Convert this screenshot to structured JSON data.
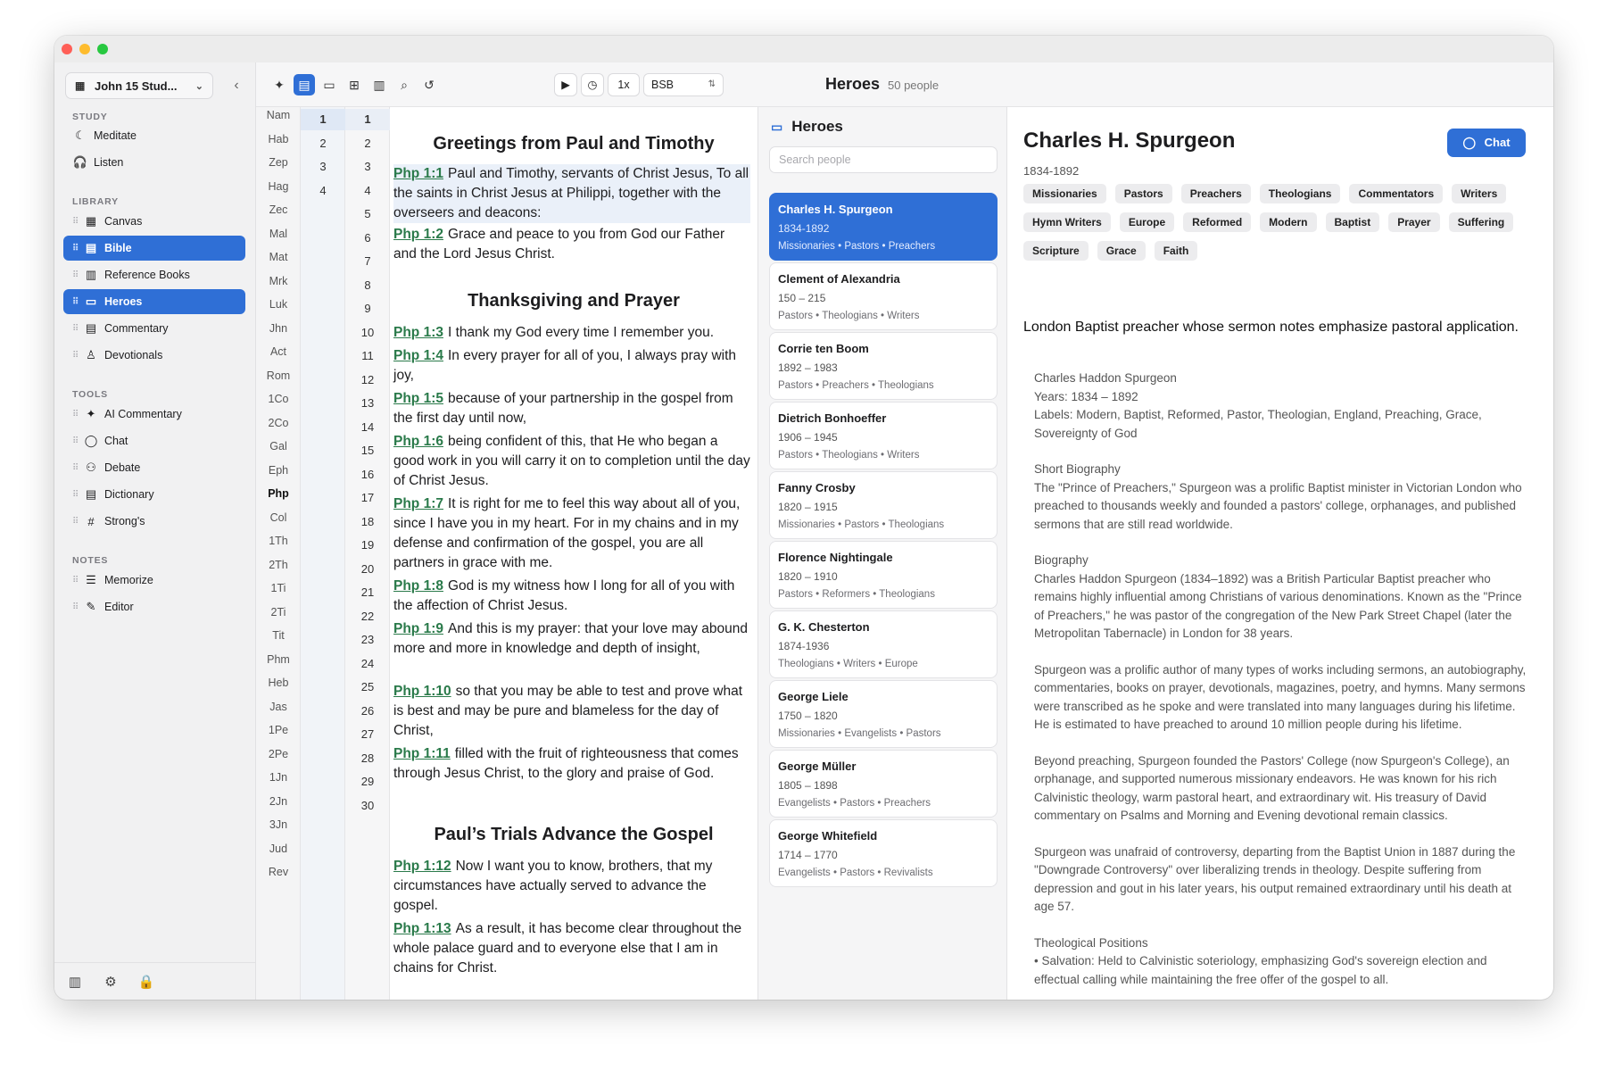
{
  "workspace": {
    "name": "John 15 Stud..."
  },
  "sidebar": {
    "sections": [
      {
        "title": "STUDY",
        "items": [
          {
            "label": "Meditate",
            "icon": "moon-icon"
          },
          {
            "label": "Listen",
            "icon": "headphones-icon"
          }
        ]
      },
      {
        "title": "LIBRARY",
        "items": [
          {
            "label": "Canvas"
          },
          {
            "label": "Bible"
          },
          {
            "label": "Reference Books"
          },
          {
            "label": "Heroes"
          },
          {
            "label": "Commentary"
          },
          {
            "label": "Devotionals"
          }
        ]
      },
      {
        "title": "TOOLS",
        "items": [
          {
            "label": "AI Commentary"
          },
          {
            "label": "Chat"
          },
          {
            "label": "Debate"
          },
          {
            "label": "Dictionary"
          },
          {
            "label": "Strong's"
          }
        ]
      },
      {
        "title": "NOTES",
        "items": [
          {
            "label": "Memorize"
          },
          {
            "label": "Editor"
          }
        ]
      }
    ]
  },
  "toolbar": {
    "speed": "1x",
    "translation": "BSB",
    "panel_title": "Heroes",
    "panel_count": "50 people"
  },
  "books": [
    "Nam",
    "Hab",
    "Zep",
    "Hag",
    "Zec",
    "Mal",
    "Mat",
    "Mrk",
    "Luk",
    "Jhn",
    "Act",
    "Rom",
    "1Co",
    "2Co",
    "Gal",
    "Eph",
    "Php",
    "Col",
    "1Th",
    "2Th",
    "1Ti",
    "2Ti",
    "Tit",
    "Phm",
    "Heb",
    "Jas",
    "1Pe",
    "2Pe",
    "1Jn",
    "2Jn",
    "3Jn",
    "Jud",
    "Rev"
  ],
  "chapters": [
    "1",
    "2",
    "3",
    "4"
  ],
  "verse_numbers": [
    "1",
    "2",
    "3",
    "4",
    "5",
    "6",
    "7",
    "8",
    "9",
    "10",
    "11",
    "12",
    "13",
    "14",
    "15",
    "16",
    "17",
    "18",
    "19",
    "20",
    "21",
    "22",
    "23",
    "24",
    "25",
    "26",
    "27",
    "28",
    "29",
    "30"
  ],
  "bible": {
    "sections": [
      "Greetings from Paul and Timothy",
      "Thanksgiving and Prayer",
      "Paul’s Trials Advance the Gospel"
    ],
    "verses": [
      {
        "ref": "Php 1:1",
        "text": "Paul and Timothy, servants of Christ Jesus, To all the saints in Christ Jesus at Philippi, together with the overseers and deacons:"
      },
      {
        "ref": "Php 1:2",
        "text": "Grace and peace to you from God our Father and the Lord Jesus Christ."
      },
      {
        "ref": "Php 1:3",
        "text": "I thank my God every time I remember you."
      },
      {
        "ref": "Php 1:4",
        "text": "In every prayer for all of you, I always pray with joy,"
      },
      {
        "ref": "Php 1:5",
        "text": "because of your partnership in the gospel from the first day until now,"
      },
      {
        "ref": "Php 1:6",
        "text": "being confident of this, that He who began a good work in you will carry it on to completion until the day of Christ Jesus."
      },
      {
        "ref": "Php 1:7",
        "text": "It is right for me to feel this way about all of you, since I have you in my heart. For in my chains and in my defense and confirmation of the gospel, you are all partners in grace with me."
      },
      {
        "ref": "Php 1:8",
        "text": "God is my witness how I long for all of you with the affection of Christ Jesus."
      },
      {
        "ref": "Php 1:9",
        "text": "And this is my prayer: that your love may abound more and more in knowledge and depth of insight,"
      },
      {
        "ref": "Php 1:10",
        "text": "so that you may be able to test and prove what is best and may be pure and blameless for the day of Christ,"
      },
      {
        "ref": "Php 1:11",
        "text": "filled with the fruit of righteousness that comes through Jesus Christ, to the glory and praise of God."
      },
      {
        "ref": "Php 1:12",
        "text": "Now I want you to know, brothers, that my circumstances have actually served to advance the gospel."
      },
      {
        "ref": "Php 1:13",
        "text": "As a result, it has become clear throughout the whole palace guard and to everyone else that I am in chains for Christ."
      }
    ]
  },
  "heroes": {
    "title": "Heroes",
    "search_placeholder": "Search people",
    "people": [
      {
        "name": "Charles H. Spurgeon",
        "years": "1834-1892",
        "tags": "Missionaries • Pastors • Preachers"
      },
      {
        "name": "Clement of Alexandria",
        "years": "150 – 215",
        "tags": "Pastors • Theologians • Writers"
      },
      {
        "name": "Corrie ten Boom",
        "years": "1892 – 1983",
        "tags": "Pastors • Preachers • Theologians"
      },
      {
        "name": "Dietrich Bonhoeffer",
        "years": "1906 – 1945",
        "tags": "Pastors • Theologians • Writers"
      },
      {
        "name": "Fanny Crosby",
        "years": "1820 – 1915",
        "tags": "Missionaries • Pastors • Theologians"
      },
      {
        "name": "Florence Nightingale",
        "years": "1820 – 1910",
        "tags": "Pastors • Reformers • Theologians"
      },
      {
        "name": "G. K. Chesterton",
        "years": "1874-1936",
        "tags": "Theologians • Writers • Europe"
      },
      {
        "name": "George Liele",
        "years": "1750 – 1820",
        "tags": "Missionaries • Evangelists • Pastors"
      },
      {
        "name": "George Müller",
        "years": "1805 – 1898",
        "tags": "Evangelists • Pastors • Preachers"
      },
      {
        "name": "George Whitefield",
        "years": "1714 – 1770",
        "tags": "Evangelists • Pastors • Revivalists"
      }
    ]
  },
  "detail": {
    "name": "Charles H. Spurgeon",
    "years": "1834-1892",
    "chat_label": "Chat",
    "chips": [
      "Missionaries",
      "Pastors",
      "Preachers",
      "Theologians",
      "Commentators",
      "Writers",
      "Hymn Writers",
      "Europe",
      "Reformed",
      "Modern",
      "Baptist",
      "Prayer",
      "Suffering",
      "Scripture",
      "Grace",
      "Faith"
    ],
    "summary": "London Baptist preacher whose sermon notes emphasize pastoral application.",
    "paragraphs": [
      [
        "Charles Haddon Spurgeon",
        "Years: 1834 – 1892",
        "Labels: Modern, Baptist, Reformed, Pastor, Theologian, England, Preaching, Grace, Sovereignty of God"
      ],
      [
        "Short Biography",
        "The \"Prince of Preachers,\" Spurgeon was a prolific Baptist minister in Victorian London who preached to thousands weekly and founded a pastors' college, orphanages, and published sermons that are still read worldwide."
      ],
      [
        "Biography",
        "Charles Haddon Spurgeon (1834–1892) was a British Particular Baptist preacher who remains highly influential among Christians of various denominations. Known as the \"Prince of Preachers,\" he was pastor of the congregation of the New Park Street Chapel (later the Metropolitan Tabernacle) in London for 38 years."
      ],
      [
        "Spurgeon was a prolific author of many types of works including sermons, an autobiography, commentaries, books on prayer, devotionals, magazines, poetry, and hymns. Many sermons were transcribed as he spoke and were translated into many languages during his lifetime. He is estimated to have preached to around 10 million people during his lifetime."
      ],
      [
        "Beyond preaching, Spurgeon founded the Pastors' College (now Spurgeon's College), an orphanage, and supported numerous missionary endeavors. He was known for his rich Calvinistic theology, warm pastoral heart, and extraordinary wit. His treasury of David commentary on Psalms and Morning and Evening devotional remain classics."
      ],
      [
        "Spurgeon was unafraid of controversy, departing from the Baptist Union in 1887 during the \"Downgrade Controversy\" over liberalizing trends in theology. Despite suffering from depression and gout in his later years, his output remained extraordinary until his death at age 57."
      ],
      [
        "Theological Positions",
        "• Salvation: Held to Calvinistic soteriology, emphasizing God's sovereign election and effectual calling while maintaining the free offer of the gospel to all."
      ]
    ]
  },
  "colors": {
    "accent": "#2f6fd6",
    "ref_link": "#2a7a4a"
  }
}
